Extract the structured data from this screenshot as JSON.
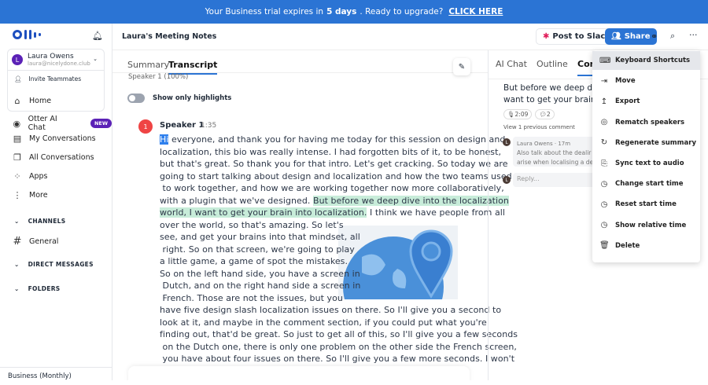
{
  "banner": {
    "pre": "Your Business trial expires in",
    "days": "5 days",
    "post": ". Ready to upgrade?",
    "link": "CLICK HERE"
  },
  "user": {
    "initial": "L",
    "name": "Laura Owens",
    "email": "laura@nicelydone.club",
    "invite": "Invite Teammates"
  },
  "nav": [
    {
      "label": "Home",
      "icon": "⌂"
    },
    {
      "label": "Otter AI Chat",
      "icon": "◉",
      "badge": "NEW"
    },
    {
      "label": "My Conversations",
      "icon": "▤"
    },
    {
      "label": "All Conversations",
      "icon": "❐"
    },
    {
      "label": "Apps",
      "icon": "⁘"
    },
    {
      "label": "More",
      "icon": "⋮"
    }
  ],
  "sections": {
    "channels": "CHANNELS",
    "general": "General",
    "dm": "DIRECT MESSAGES",
    "folders": "FOLDERS"
  },
  "plan": "Business (Monthly)",
  "header": {
    "title": "Laura's Meeting Notes",
    "slack": "Post to Slack",
    "share": "Share"
  },
  "main": {
    "tabs": [
      "Summary",
      "Transcript"
    ],
    "speaker_stats": "Speaker 1 (100%)",
    "toggle_label": "Show only highlights",
    "speaker_num": "1",
    "speaker": "Speaker 1",
    "time": "1:35",
    "lines": [
      {
        "hl_start": "Hi",
        "pre": "",
        "post": " everyone, and thank you for having me today for this session on design and"
      },
      {
        "pre": "localization, this bio was really intense. I had forgotten bits of it, to be honest,"
      },
      {
        "pre": "but that's great. So thank you for that intro. Let's get cracking. So today we are"
      },
      {
        "pre": "going to start talking about design and localization and how the two teams used"
      },
      {
        "pre": " to work together, and how we are working together now more collaboratively,"
      },
      {
        "pre": "with a plugin that we've designed. ",
        "hl": "But before we deep dive into the localization"
      },
      {
        "pre": "",
        "hl": "world, I want to get your brain into localization.",
        "post": " I think we have people from all"
      },
      {
        "pre": "over the world, so that's amazing. So let's"
      },
      {
        "pre": "see, and get your brains into that mindset, all"
      },
      {
        "pre": " right. So on that screen, we're going to play"
      },
      {
        "pre": "a little game, a game of spot the mistakes."
      },
      {
        "pre": "So on the left hand side, you have a screen in"
      },
      {
        "pre": " Dutch, and on the right hand side a screen in"
      },
      {
        "pre": " French. Those are not the issues, but you"
      },
      {
        "pre": "have five design slash localization issues on there. So I'll give you a second to"
      },
      {
        "pre": "look at it, and maybe in the comment section, if you could put what you're"
      },
      {
        "pre": "finding out, that'd be great. So just to get all of this, so I'll give you a few seconds"
      },
      {
        "pre": " on the Dutch one, there is only one problem on the other side the French screen,"
      },
      {
        "pre": " you have about four issues on there. So I'll give you a few more seconds. I won't"
      }
    ]
  },
  "right": {
    "tabs": [
      "AI Chat",
      "Outline",
      "Com"
    ],
    "quote1": "But before we deep dive i",
    "quote2": "want to get your brain int",
    "audio_time": "2:09",
    "comment_count": "2",
    "view_prev": "View 1 previous comment",
    "commenter": "Laura Owens",
    "ago": "17m",
    "comment1": "Also talk about the dealir",
    "comment2": "arise when localising a de",
    "reply": "Reply..."
  },
  "menu": [
    {
      "label": "Keyboard Shortcuts",
      "icon": "⌨"
    },
    {
      "label": "Move",
      "icon": "⇥"
    },
    {
      "label": "Export",
      "icon": "↥"
    },
    {
      "label": "Rematch speakers",
      "icon": "◎"
    },
    {
      "label": "Regenerate summary",
      "icon": "↻"
    },
    {
      "label": "Sync text to audio",
      "icon": "⎘"
    },
    {
      "label": "Change start time",
      "icon": "◷"
    },
    {
      "label": "Reset start time",
      "icon": "◷"
    },
    {
      "label": "Show relative time",
      "icon": "◷"
    },
    {
      "label": "Delete",
      "icon": "🗑"
    }
  ],
  "colors": {
    "banner": "#2b74d4",
    "highlight": "#c7ecd9",
    "accent": "#2b74d4"
  }
}
